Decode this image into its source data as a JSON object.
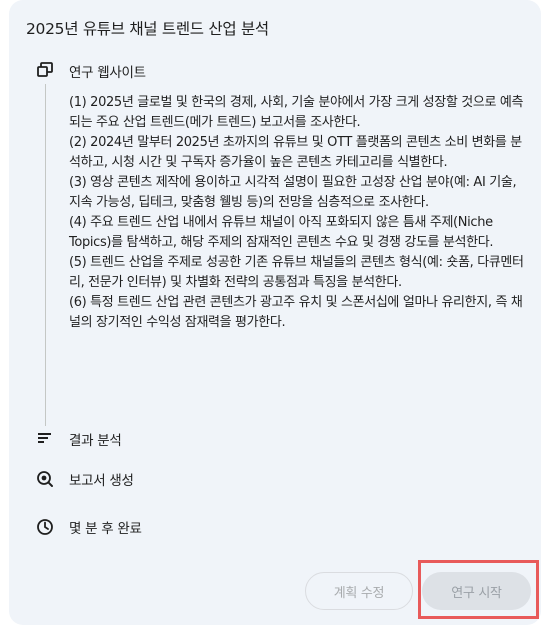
{
  "plan": {
    "title": "2025년 유튜브 채널 트렌드 산업 분석"
  },
  "steps": [
    {
      "icon": "web-research-icon",
      "label": "연구 웹사이트"
    },
    {
      "icon": "analysis-icon",
      "label": "결과 분석"
    },
    {
      "icon": "report-icon",
      "label": "보고서 생성"
    },
    {
      "icon": "clock-icon",
      "label": "몇 분 후 완료"
    }
  ],
  "details": [
    "(1) 2025년 글로벌 및 한국의 경제, 사회, 기술 분야에서 가장 크게 성장할 것으로 예측되는 주요 산업 트렌드(메가 트렌드) 보고서를 조사한다.",
    "(2) 2024년 말부터 2025년 초까지의 유튜브 및 OTT 플랫폼의 콘텐츠 소비 변화를 분석하고, 시청 시간 및 구독자 증가율이 높은 콘텐츠 카테고리를 식별한다.",
    "(3) 영상 콘텐츠 제작에 용이하고 시각적 설명이 필요한 고성장 산업 분야(예: AI 기술, 지속 가능성, 딥테크, 맞춤형 웰빙 등)의 전망을 심층적으로 조사한다.",
    "(4) 주요 트렌드 산업 내에서 유튜브 채널이 아직 포화되지 않은 틈새 주제(Niche Topics)를 탐색하고, 해당 주제의 잠재적인 콘텐츠 수요 및 경쟁 강도를 분석한다.",
    "(5) 트렌드 산업을 주제로 성공한 기존 유튜브 채널들의 콘텐츠 형식(예: 숏폼, 다큐멘터리, 전문가 인터뷰) 및 차별화 전략의 공통점과 특징을 분석한다.",
    "(6) 특정 트렌드 산업 관련 콘텐츠가 광고주 유치 및 스폰서십에 얼마나 유리한지, 즉 채널의 장기적인 수익성 잠재력을 평가한다."
  ],
  "buttons": {
    "edit_plan": "계획 수정",
    "start_research": "연구 시작"
  },
  "colors": {
    "card_background": "#f0f4f9",
    "highlight_border": "#e85a5a",
    "disabled_text": "#9aa0a6"
  }
}
